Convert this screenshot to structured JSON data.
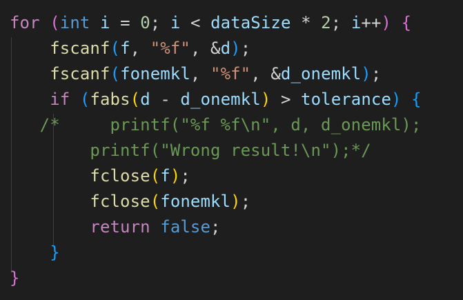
{
  "editor": {
    "theme_background": "#1e1e1e",
    "language": "c",
    "lines": [
      [
        {
          "t": "for",
          "c": "kw"
        },
        {
          "t": " ",
          "c": "op"
        },
        {
          "t": "(",
          "c": "b2"
        },
        {
          "t": "int",
          "c": "ty"
        },
        {
          "t": " ",
          "c": "op"
        },
        {
          "t": "i",
          "c": "var"
        },
        {
          "t": " = ",
          "c": "op"
        },
        {
          "t": "0",
          "c": "num"
        },
        {
          "t": "; ",
          "c": "op"
        },
        {
          "t": "i",
          "c": "var"
        },
        {
          "t": " < ",
          "c": "op"
        },
        {
          "t": "dataSize",
          "c": "var"
        },
        {
          "t": " * ",
          "c": "op"
        },
        {
          "t": "2",
          "c": "num"
        },
        {
          "t": "; ",
          "c": "op"
        },
        {
          "t": "i",
          "c": "var"
        },
        {
          "t": "++",
          "c": "op"
        },
        {
          "t": ")",
          "c": "b2"
        },
        {
          "t": " ",
          "c": "op"
        },
        {
          "t": "{",
          "c": "b2"
        }
      ],
      [
        {
          "t": "    ",
          "c": "op"
        },
        {
          "t": "fscanf",
          "c": "fn"
        },
        {
          "t": "(",
          "c": "b3"
        },
        {
          "t": "f",
          "c": "var"
        },
        {
          "t": ", ",
          "c": "op"
        },
        {
          "t": "\"%f\"",
          "c": "str"
        },
        {
          "t": ", &",
          "c": "op"
        },
        {
          "t": "d",
          "c": "var"
        },
        {
          "t": ")",
          "c": "b3"
        },
        {
          "t": ";",
          "c": "op"
        }
      ],
      [
        {
          "t": "    ",
          "c": "op"
        },
        {
          "t": "fscanf",
          "c": "fn"
        },
        {
          "t": "(",
          "c": "b3"
        },
        {
          "t": "fonemkl",
          "c": "var"
        },
        {
          "t": ", ",
          "c": "op"
        },
        {
          "t": "\"%f\"",
          "c": "str"
        },
        {
          "t": ", &",
          "c": "op"
        },
        {
          "t": "d_onemkl",
          "c": "var"
        },
        {
          "t": ")",
          "c": "b3"
        },
        {
          "t": ";",
          "c": "op"
        }
      ],
      [
        {
          "t": "    ",
          "c": "op"
        },
        {
          "t": "if",
          "c": "kw"
        },
        {
          "t": " ",
          "c": "op"
        },
        {
          "t": "(",
          "c": "b3"
        },
        {
          "t": "fabs",
          "c": "fn"
        },
        {
          "t": "(",
          "c": "b1"
        },
        {
          "t": "d",
          "c": "var"
        },
        {
          "t": " - ",
          "c": "op"
        },
        {
          "t": "d_onemkl",
          "c": "var"
        },
        {
          "t": ")",
          "c": "b1"
        },
        {
          "t": " > ",
          "c": "op"
        },
        {
          "t": "tolerance",
          "c": "var"
        },
        {
          "t": ")",
          "c": "b3"
        },
        {
          "t": " ",
          "c": "op"
        },
        {
          "t": "{",
          "c": "b3"
        }
      ],
      [
        {
          "t": "   /*     printf(\"%f %f\\n\", d, d_onemkl);",
          "c": "cm"
        }
      ],
      [
        {
          "t": "        printf(\"Wrong result!\\n\");*/",
          "c": "cm"
        }
      ],
      [
        {
          "t": "        ",
          "c": "op"
        },
        {
          "t": "fclose",
          "c": "fn"
        },
        {
          "t": "(",
          "c": "b1"
        },
        {
          "t": "f",
          "c": "var"
        },
        {
          "t": ")",
          "c": "b1"
        },
        {
          "t": ";",
          "c": "op"
        }
      ],
      [
        {
          "t": "        ",
          "c": "op"
        },
        {
          "t": "fclose",
          "c": "fn"
        },
        {
          "t": "(",
          "c": "b1"
        },
        {
          "t": "fonemkl",
          "c": "var"
        },
        {
          "t": ")",
          "c": "b1"
        },
        {
          "t": ";",
          "c": "op"
        }
      ],
      [
        {
          "t": "        ",
          "c": "op"
        },
        {
          "t": "return",
          "c": "kw"
        },
        {
          "t": " ",
          "c": "op"
        },
        {
          "t": "false",
          "c": "ty"
        },
        {
          "t": ";",
          "c": "op"
        }
      ],
      [
        {
          "t": "    ",
          "c": "op"
        },
        {
          "t": "}",
          "c": "b3"
        }
      ],
      [
        {
          "t": "}",
          "c": "b2"
        }
      ]
    ]
  }
}
